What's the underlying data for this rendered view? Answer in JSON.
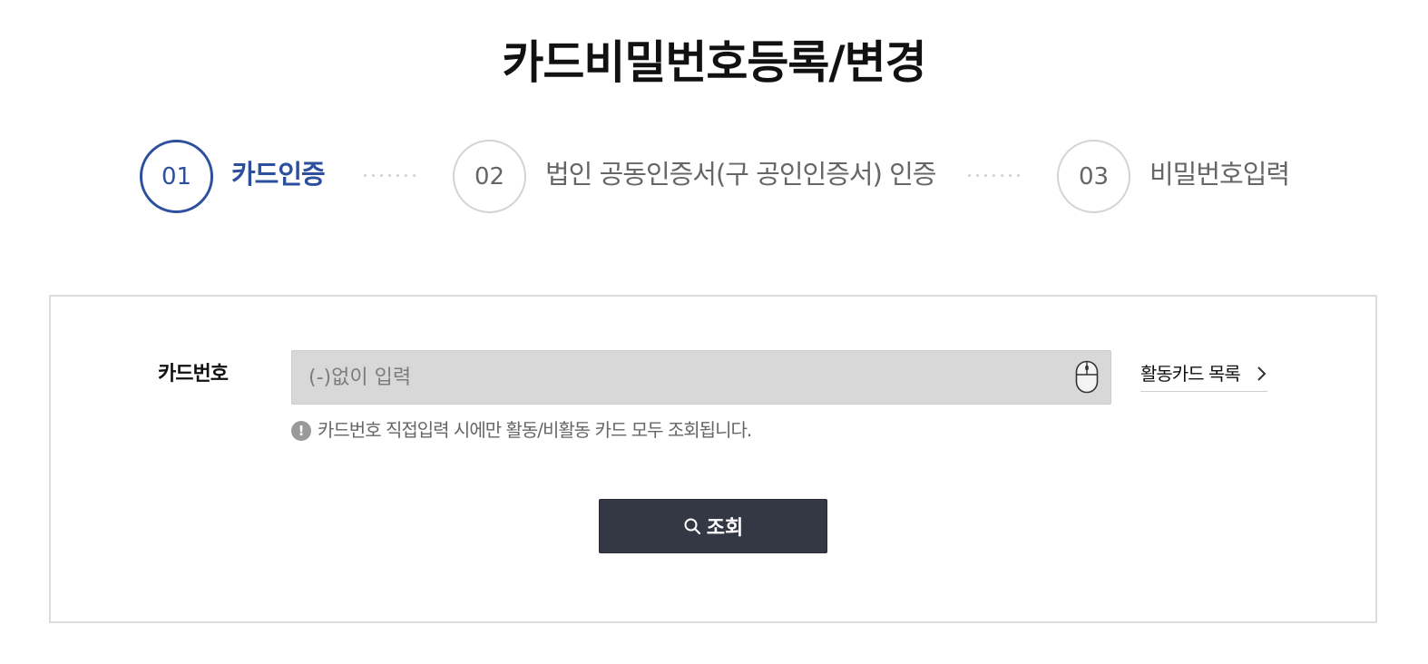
{
  "page": {
    "title": "카드비밀번호등록/변경"
  },
  "steps": [
    {
      "number": "01",
      "label": "카드인증",
      "active": true
    },
    {
      "number": "02",
      "label": "법인 공동인증서(구 공인인증서) 인증",
      "active": false
    },
    {
      "number": "03",
      "label": "비밀번호입력",
      "active": false
    }
  ],
  "form": {
    "card_number_label": "카드번호",
    "card_number_value": "",
    "card_number_placeholder": "(-)없이 입력",
    "input_icon": "mouse-icon",
    "card_list_link": "활동카드 목록",
    "notice_icon": "!",
    "notice_text": "카드번호 직접입력 시에만 활동/비활동 카드 모두 조회됩니다.",
    "search_button": "조회"
  },
  "colors": {
    "accent": "#2c4f9e",
    "button_bg": "#343844",
    "input_bg": "#d8d8d8",
    "border": "#dcdcdc"
  }
}
